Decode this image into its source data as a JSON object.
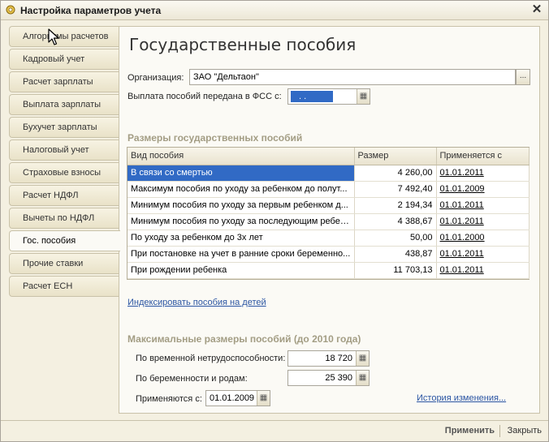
{
  "window": {
    "title": "Настройка параметров учета",
    "close": "✕"
  },
  "sidebar": {
    "tabs": [
      "Алгоритмы расчетов",
      "Кадровый учет",
      "Расчет зарплаты",
      "Выплата зарплаты",
      "Бухучет зарплаты",
      "Налоговый учет",
      "Страховые взносы",
      "Расчет НДФЛ",
      "Вычеты по НДФЛ",
      "Гос. пособия",
      "Прочие ставки",
      "Расчет ЕСН"
    ],
    "active_index": 9
  },
  "main": {
    "heading": "Государственные пособия",
    "org_label": "Организация:",
    "org_value": "ЗАО \"Дельтаон\"",
    "org_button": "...",
    "fss_label": "Выплата пособий передана в ФСС с:",
    "fss_value": ". .",
    "sizes_title": "Размеры государственных пособий",
    "table": {
      "headers": [
        "Вид пособия",
        "Размер",
        "Применяется с"
      ],
      "rows": [
        [
          "В связи со смертью",
          "4 260,00",
          "01.01.2011"
        ],
        [
          "Максимум пособия по уходу за ребенком до полут...",
          "7 492,40",
          "01.01.2009"
        ],
        [
          "Минимум пособия по уходу за первым ребенком д...",
          "2 194,34",
          "01.01.2011"
        ],
        [
          "Минимум пособия по уходу за последующим ребен...",
          "4 388,67",
          "01.01.2011"
        ],
        [
          "По уходу за ребенком до 3х лет",
          "50,00",
          "01.01.2000"
        ],
        [
          "При постановке на учет в ранние сроки беременно...",
          "438,87",
          "01.01.2011"
        ],
        [
          "При рождении ребенка",
          "11 703,13",
          "01.01.2011"
        ]
      ],
      "selected_row": 0
    },
    "index_link": "Индексировать пособия на детей",
    "max_title": "Максимальные размеры пособий (до 2010 года)",
    "temp_label": "По временной нетрудоспособности:",
    "temp_value": "18 720",
    "preg_label": "По беременности и родам:",
    "preg_value": "25 390",
    "applied_label": "Применяются с:",
    "applied_value": "01.01.2009",
    "history_link": "История изменения..."
  },
  "footer": {
    "apply": "Применить",
    "close": "Закрыть"
  },
  "colors": {
    "selection": "#316ac5",
    "link": "#2b55a3",
    "section": "#a39d84"
  },
  "icons": {
    "calendar": "calendar-icon",
    "app": "app-gear-icon",
    "cursor": "mouse-pointer-icon"
  }
}
